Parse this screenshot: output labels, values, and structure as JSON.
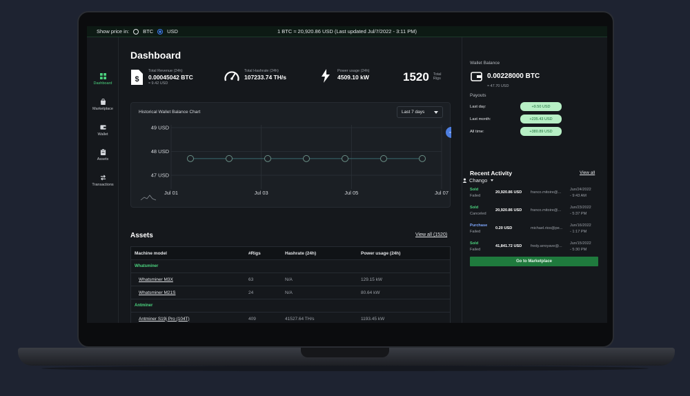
{
  "topbar": {
    "show_price_label": "Show price in:",
    "currency_options": [
      "BTC",
      "USD"
    ],
    "selected_currency": "USD",
    "rate_text": "1 BTC ≈ 20,920.86 USD (Last updated Jul/7/2022 - 3:11 PM)",
    "user_name": "Chango"
  },
  "sidebar": {
    "items": [
      {
        "label": "Dashboard",
        "icon": "grid-icon",
        "active": true
      },
      {
        "label": "Marketplace",
        "icon": "bag-icon",
        "active": false
      },
      {
        "label": "Wallet",
        "icon": "wallet-icon",
        "active": false
      },
      {
        "label": "Assets",
        "icon": "clipboard-icon",
        "active": false
      },
      {
        "label": "Transactions",
        "icon": "arrows-icon",
        "active": false
      }
    ]
  },
  "dashboard": {
    "title": "Dashboard",
    "kpis": {
      "revenue": {
        "label": "Total Revenue (24h)",
        "value": "0.00045042 BTC",
        "sub": "≈ 9.42 USD"
      },
      "hashrate": {
        "label": "Total Hashrate (24h)",
        "value": "107233.74 TH/s"
      },
      "power": {
        "label": "Power usage (24h)",
        "value": "4509.10 kW"
      },
      "rigs": {
        "value": "1520",
        "label_line1": "Total",
        "label_line2": "Rigs"
      }
    }
  },
  "chart": {
    "title": "Historical Wallet Balance Chart",
    "range_selected": "Last 7 days"
  },
  "chart_data": {
    "type": "line",
    "title": "Historical Wallet Balance Chart",
    "x": [
      "Jul 01",
      "Jul 02",
      "Jul 03",
      "Jul 04",
      "Jul 05",
      "Jul 06",
      "Jul 07"
    ],
    "x_tick_labels": [
      "Jul 01",
      "Jul 03",
      "Jul 05",
      "Jul 07"
    ],
    "y_tick_labels": [
      "49 USD",
      "48 USD",
      "47 USD"
    ],
    "ylim": [
      47,
      49
    ],
    "series": [
      {
        "values": [
          47.7,
          47.7,
          47.7,
          47.7,
          47.7,
          47.7,
          47.7
        ]
      }
    ],
    "highlight_point": {
      "x": "Jul 07",
      "y": 48.8
    },
    "grid": true,
    "colors": {
      "line": "#3b6b6f",
      "marker": "#6a8f86",
      "highlight": "#4d7ee0"
    }
  },
  "assets": {
    "title": "Assets",
    "view_all": "View all (1520)",
    "columns": [
      "Machine model",
      "#Rigs",
      "Hashrate (24h)",
      "Power usage (24h)"
    ],
    "groups": [
      {
        "name": "Whatsminer",
        "rows": [
          {
            "model": "Whatsminer M3X",
            "rigs": "63",
            "hashrate": "N/A",
            "power": "129.15 kW"
          },
          {
            "model": "Whatsminer M21S",
            "rigs": "24",
            "hashrate": "N/A",
            "power": "80.64 kW"
          }
        ]
      },
      {
        "name": "Antminer",
        "rows": [
          {
            "model": "Antminer S19j Pro (104T)",
            "rigs": "409",
            "hashrate": "41527.64 TH/s",
            "power": "1193.45 kW"
          }
        ]
      }
    ]
  },
  "wallet": {
    "label": "Wallet Balance",
    "value": "0.00228000 BTC",
    "sub": "≈ 47.70 USD",
    "payouts_label": "Payouts",
    "payouts": [
      {
        "label": "Last day:",
        "value": "+9.50 USD"
      },
      {
        "label": "Last month:",
        "value": "+235.43 USD"
      },
      {
        "label": "All time:",
        "value": "+380.89 USD"
      }
    ]
  },
  "activity": {
    "title": "Recent Activity",
    "view_all": "View all",
    "items": [
      {
        "type": "Sold",
        "status": "Failed",
        "amount": "20,920.86 USD",
        "email": "franco.mitoire@...",
        "date": "Jun/24/2022",
        "time": "- 9:43 AM"
      },
      {
        "type": "Sold",
        "status": "Canceled",
        "amount": "20,920.86 USD",
        "email": "franco.mitoire@...",
        "date": "Jun/23/2022",
        "time": "- 5:37 PM"
      },
      {
        "type": "Purchase",
        "status": "Failed",
        "amount": "0.20 USD",
        "email": "michael.rios@pe...",
        "date": "Jun/16/2022",
        "time": "- 1:17 PM"
      },
      {
        "type": "Sold",
        "status": "Failed",
        "amount": "41,841.72 USD",
        "email": "fredy.arroyave@...",
        "date": "Jun/15/2022",
        "time": "- 5:30 PM"
      }
    ],
    "colors": {
      "sold": "#4cd47f",
      "purchase": "#7fa8ff"
    },
    "cta": "Go to Marketplace"
  }
}
